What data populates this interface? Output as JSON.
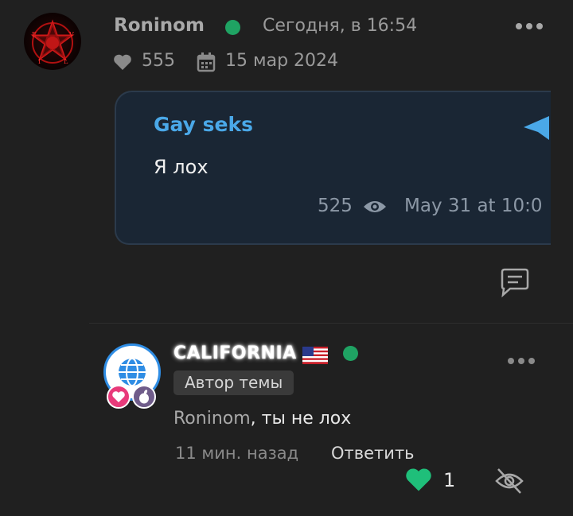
{
  "post": {
    "author": "Roninom",
    "time": "Сегодня, в 16:54",
    "likes": "555",
    "reg_date": "15 мар 2024"
  },
  "quote": {
    "title": "Gay seks",
    "text": "Я лох",
    "views": "525",
    "date": "May 31 at 10:0"
  },
  "reply": {
    "author": "CALIFORNIA",
    "role": "Автор темы",
    "mention": "Roninom",
    "text": ", ты не лох",
    "time_ago": "11 мин. назад",
    "reply_label": "Ответить",
    "likes": "1"
  },
  "colors": {
    "online": "#1fa363",
    "quote_accent": "#4aa8e8",
    "like_green": "#1fbf7a"
  }
}
